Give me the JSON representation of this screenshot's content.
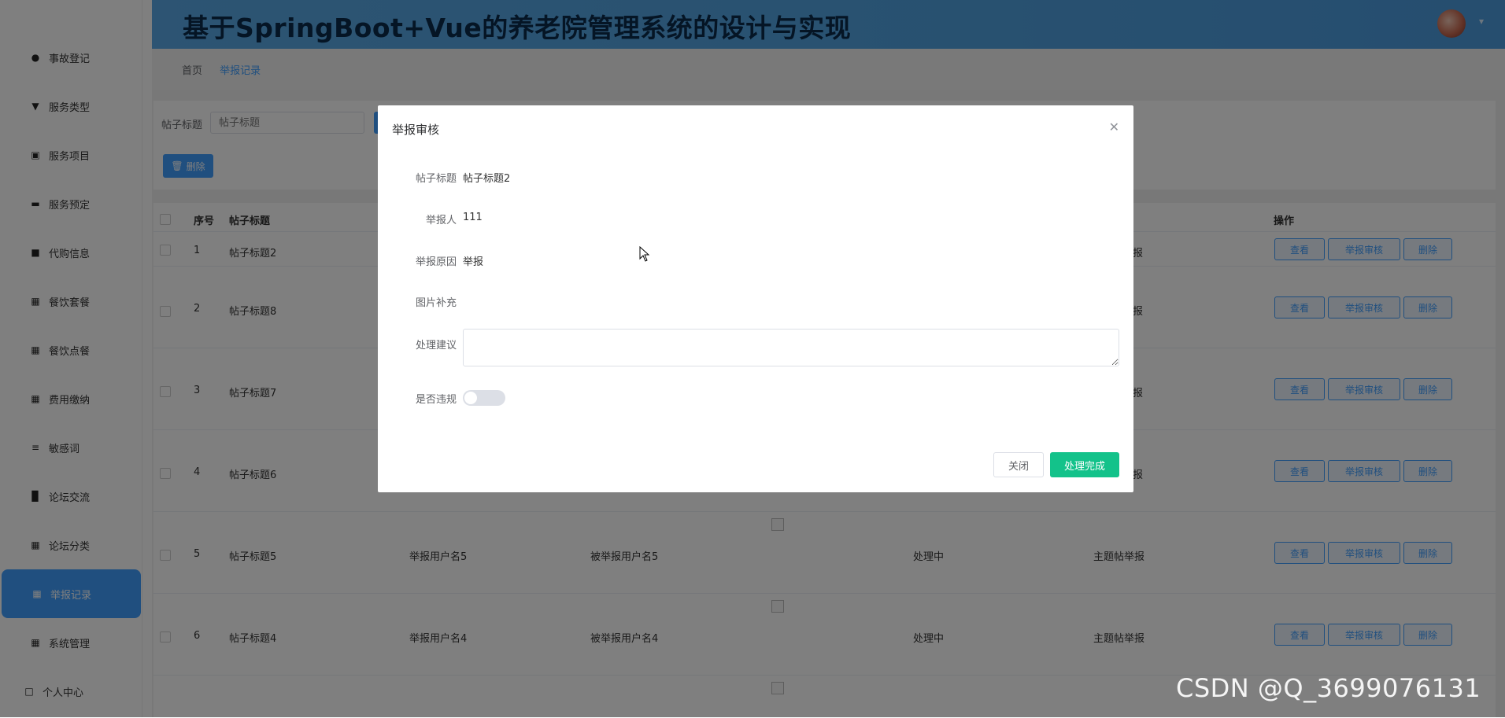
{
  "header": {
    "title": "基于SpringBoot+Vue的养老院管理系统的设计与实现"
  },
  "breadcrumb": {
    "home": "首页",
    "current": "举报记录"
  },
  "sidebar": {
    "items": [
      {
        "label": "事故登记",
        "icon": "user-icon"
      },
      {
        "label": "服务类型",
        "icon": "tag-icon"
      },
      {
        "label": "服务项目",
        "icon": "document-icon"
      },
      {
        "label": "服务预定",
        "icon": "ticket-icon"
      },
      {
        "label": "代购信息",
        "icon": "briefcase-icon"
      },
      {
        "label": "餐饮套餐",
        "icon": "grid-icon"
      },
      {
        "label": "餐饮点餐",
        "icon": "grid-icon"
      },
      {
        "label": "费用缴纳",
        "icon": "grid-icon"
      },
      {
        "label": "敏感词",
        "icon": "sliders-icon"
      },
      {
        "label": "论坛交流",
        "icon": "chart-icon"
      },
      {
        "label": "论坛分类",
        "icon": "grid-icon"
      },
      {
        "label": "举报记录",
        "icon": "grid-icon",
        "active": true
      },
      {
        "label": "系统管理",
        "icon": "grid-icon"
      }
    ],
    "personal": "个人中心"
  },
  "search": {
    "label": "帖子标题",
    "placeholder": "帖子标题"
  },
  "toolbar": {
    "delete_label": "删除"
  },
  "table": {
    "columns": {
      "index": "序号",
      "title": "帖子标题",
      "ops": "操作"
    },
    "rows": [
      {
        "index": "1",
        "title": "帖子标题2",
        "reporter": "",
        "reported": "",
        "status": "",
        "type": "报"
      },
      {
        "index": "2",
        "title": "帖子标题8",
        "reporter": "",
        "reported": "",
        "status": "",
        "type": "报"
      },
      {
        "index": "3",
        "title": "帖子标题7",
        "reporter": "",
        "reported": "",
        "status": "",
        "type": "报"
      },
      {
        "index": "4",
        "title": "帖子标题6",
        "reporter": "",
        "reported": "",
        "status": "",
        "type": "报"
      },
      {
        "index": "5",
        "title": "帖子标题5",
        "reporter": "举报用户名5",
        "reported": "被举报用户名5",
        "status": "处理中",
        "type": "主题帖举报"
      },
      {
        "index": "6",
        "title": "帖子标题4",
        "reporter": "举报用户名4",
        "reported": "被举报用户名4",
        "status": "处理中",
        "type": "主题帖举报"
      }
    ],
    "ops": {
      "view": "查看",
      "review": "举报审核",
      "delete": "删除"
    }
  },
  "dialog": {
    "title": "举报审核",
    "fields": {
      "post_title_label": "帖子标题",
      "post_title_value": "帖子标题2",
      "reporter_label": "举报人",
      "reporter_value": "111",
      "reason_label": "举报原因",
      "reason_value": "举报",
      "image_label": "图片补充",
      "suggestion_label": "处理建议",
      "suggestion_value": "",
      "violation_label": "是否违规",
      "violation_on": false
    },
    "buttons": {
      "close": "关闭",
      "done": "处理完成"
    }
  },
  "watermark": "CSDN @Q_3699076131"
}
